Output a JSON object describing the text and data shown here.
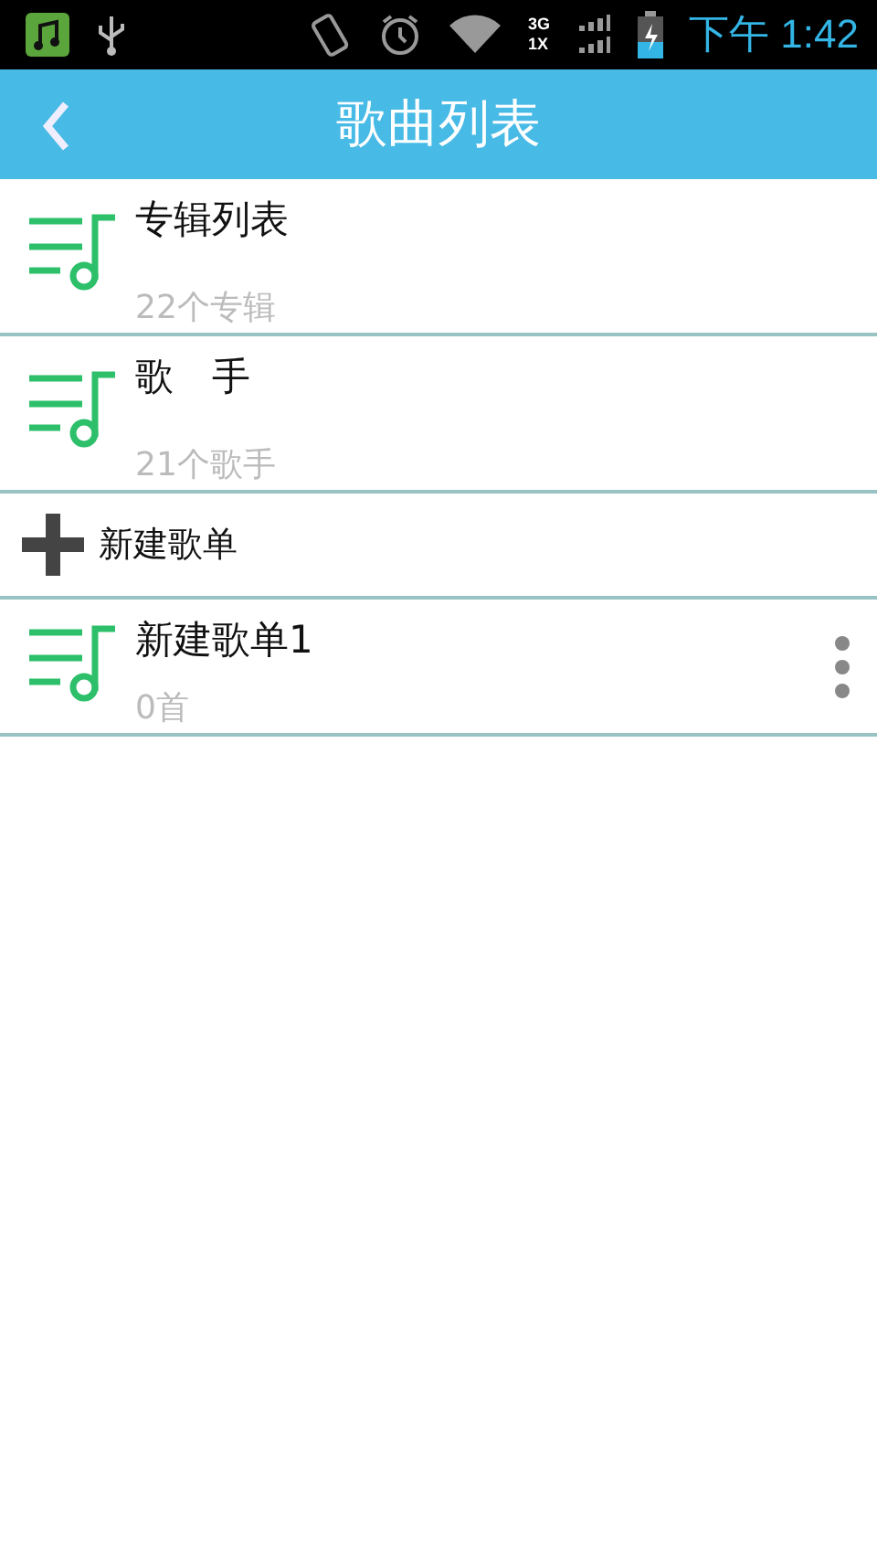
{
  "status_bar": {
    "network_labels": [
      "3G",
      "1X"
    ],
    "time": "下午 1:42"
  },
  "app_bar": {
    "title": "歌曲列表"
  },
  "items": [
    {
      "kind": "group",
      "title": "专辑列表",
      "subtitle": "22个专辑",
      "has_menu": false
    },
    {
      "kind": "group",
      "title": "歌　手",
      "subtitle": "21个歌手",
      "has_menu": false
    },
    {
      "kind": "add",
      "title": "新建歌单"
    },
    {
      "kind": "playlist",
      "title": "新建歌单1",
      "subtitle": "0首",
      "has_menu": true
    }
  ]
}
